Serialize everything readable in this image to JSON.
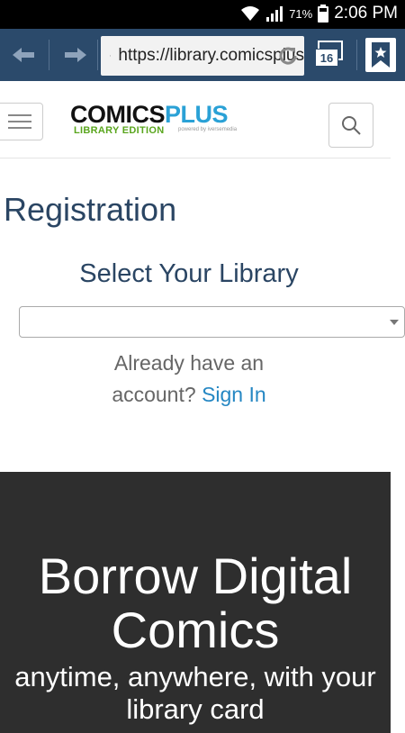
{
  "status_bar": {
    "battery_percent": "71%",
    "time": "2:06 PM",
    "icons": [
      "wifi-icon",
      "signal-icon",
      "battery-icon"
    ]
  },
  "browser": {
    "url": "https://library.comicsplus",
    "tab_count": "16",
    "icons": [
      "back-arrow-icon",
      "forward-arrow-icon",
      "lock-icon",
      "refresh-icon",
      "tabs-icon",
      "bookmark-icon"
    ]
  },
  "site_header": {
    "logo_comics": "COMICS",
    "logo_plus": "PLUS",
    "logo_edition": "LIBRARY EDITION",
    "logo_powered": "powered by iversemedia",
    "icons": [
      "hamburger-menu-icon",
      "search-icon"
    ]
  },
  "registration": {
    "title": "Registration",
    "select_label": "Select Your Library",
    "select_value": "",
    "already_text": "Already have an account?",
    "sign_in_link": "Sign In"
  },
  "hero": {
    "headline": "Borrow Digital Comics",
    "subline": "anytime, anywhere, with your library card"
  },
  "colors": {
    "browser_bar": "#2b4a6b",
    "heading": "#2a4563",
    "link": "#2587c3",
    "hero_bg": "#2e2e2e",
    "logo_plus": "#2aa1d6",
    "logo_edition": "#5aa61e"
  }
}
